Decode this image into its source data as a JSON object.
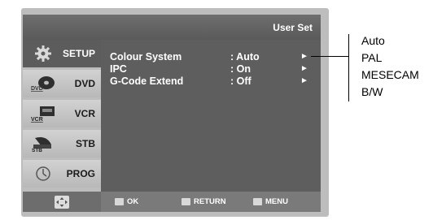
{
  "title": "User Set",
  "sidebar": [
    {
      "label": "SETUP",
      "icon": "gear-icon",
      "active": true
    },
    {
      "label": "DVD",
      "icon": "dvd-disc-icon",
      "active": false
    },
    {
      "label": "VCR",
      "icon": "vcr-tape-icon",
      "active": false
    },
    {
      "label": "STB",
      "icon": "stb-satellite-icon",
      "active": false
    },
    {
      "label": "PROG",
      "icon": "prog-timer-icon",
      "active": false
    }
  ],
  "rows": [
    {
      "label": "Colour System",
      "value": ": Auto",
      "arrow": "►"
    },
    {
      "label": "IPC",
      "value": ": On",
      "arrow": "►"
    },
    {
      "label": "G-Code Extend",
      "value": ": Off",
      "arrow": "►"
    }
  ],
  "footer": {
    "ok": "OK",
    "return": "RETURN",
    "menu": "MENU"
  },
  "options": [
    "Auto",
    "PAL",
    "MESECAM",
    "B/W"
  ]
}
